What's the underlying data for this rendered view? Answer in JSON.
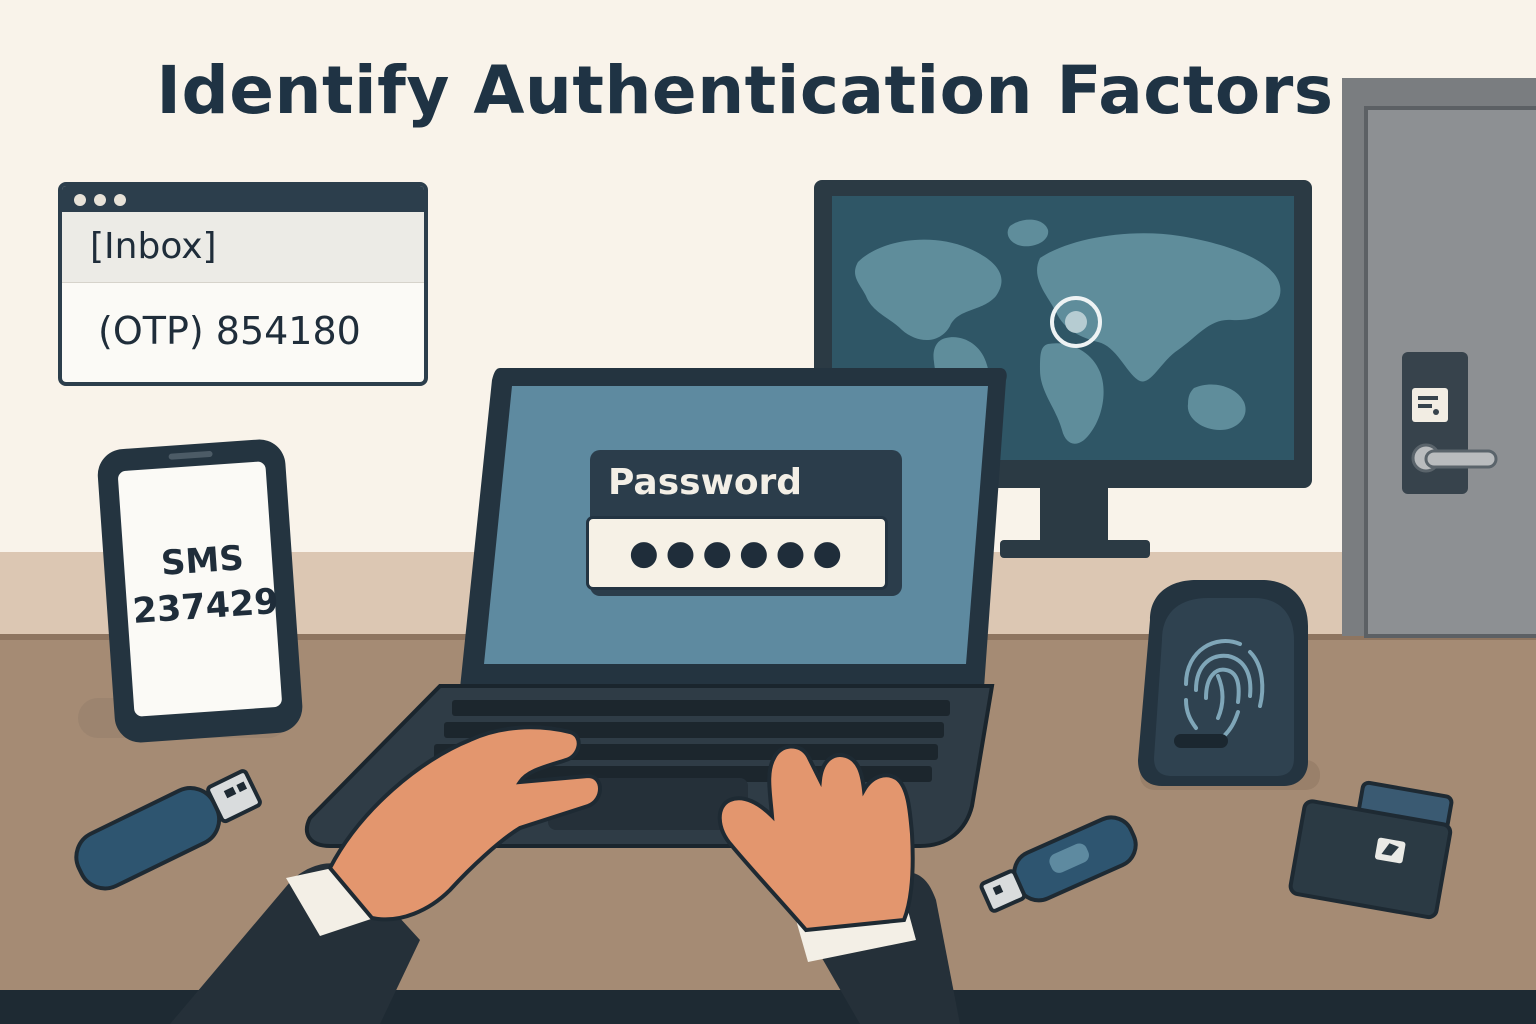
{
  "title": "Identify Authentication Factors",
  "inbox": {
    "header": "[Inbox]",
    "message": "(OTP) 854180"
  },
  "phone": {
    "sms_label": "SMS",
    "sms_code": "237429"
  },
  "laptop": {
    "password_label": "Password",
    "password_mask": "●●●●●●"
  },
  "colors": {
    "wall": "#f9f3ea",
    "desk": "#a58b74",
    "dark_ink": "#1f3344",
    "screen_blue": "#5e8aa0",
    "monitor_teal": "#2f5666",
    "skin": "#e3966e",
    "door_gray": "#7a7d80"
  },
  "icons": [
    "mail-window-icon",
    "smartphone-icon",
    "laptop-icon",
    "world-map-icon",
    "location-pin-icon",
    "fingerprint-scanner-icon",
    "usb-key-icon",
    "smart-card-icon",
    "door-lock-icon"
  ]
}
